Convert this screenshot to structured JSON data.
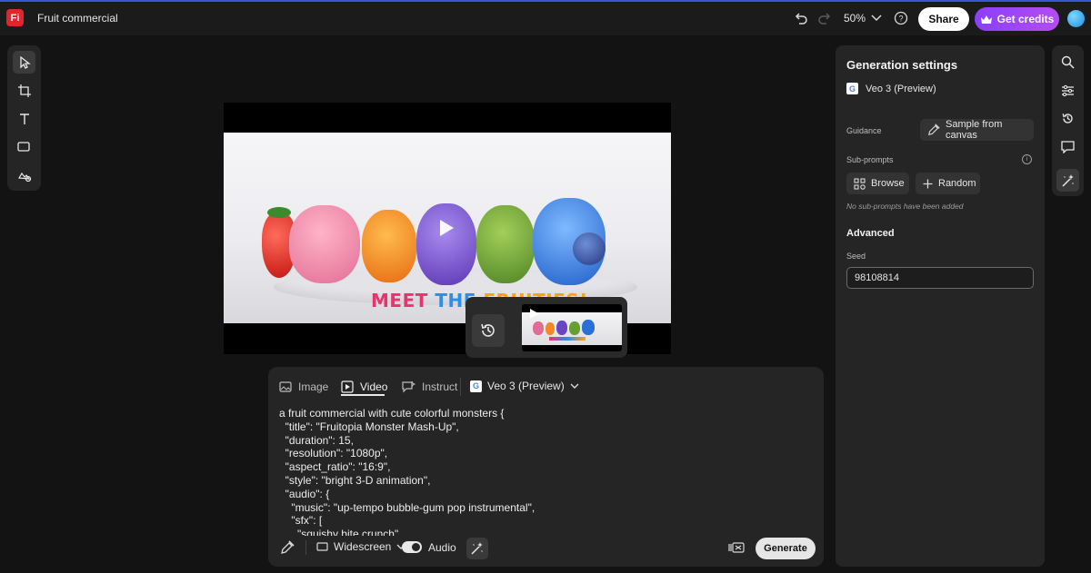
{
  "app": {
    "logo_text": "Fi",
    "document_title": "Fruit commercial"
  },
  "topbar": {
    "zoom_level": "50%",
    "share_label": "Share",
    "credits_label": "Get credits"
  },
  "left_toolbar": {
    "tools": [
      "select-tool",
      "crop-tool",
      "text-tool",
      "shape-tool",
      "generate-fill-tool"
    ]
  },
  "canvas": {
    "video_caption_text": "MEET THE FRUITIES!"
  },
  "prompt_panel": {
    "tabs": [
      {
        "label": "Image",
        "active": false
      },
      {
        "label": "Video",
        "active": true
      },
      {
        "label": "Instruct",
        "active": false
      }
    ],
    "model": "Veo 3 (Preview)",
    "prompt_text": "a fruit commercial with cute colorful monsters {\n  \"title\": \"Fruitopia Monster Mash-Up\",\n  \"duration\": 15,\n  \"resolution\": \"1080p\",\n  \"aspect_ratio\": \"16:9\",\n  \"style\": \"bright 3-D animation\",\n  \"audio\": {\n    \"music\": \"up-tempo bubble-gum pop instrumental\",\n    \"sfx\": [\n      \"squishy bite crunch\",",
    "aspect_label": "Widescreen",
    "audio_label": "Audio",
    "audio_enabled": true,
    "generate_label": "Generate"
  },
  "settings_panel": {
    "title": "Generation settings",
    "model": "Veo 3 (Preview)",
    "guidance_label": "Guidance",
    "sample_button_label": "Sample from canvas",
    "subprompts_label": "Sub-prompts",
    "browse_label": "Browse",
    "random_label": "Random",
    "subprompts_note": "No sub-prompts have been added",
    "advanced_label": "Advanced",
    "seed_label": "Seed",
    "seed_value": "98108814"
  },
  "colors": {
    "accent_blue": "#3a56d4",
    "credits_gradient_start": "#8a3ffc",
    "credits_gradient_end": "#b44df0",
    "logo_red": "#e3242b"
  }
}
